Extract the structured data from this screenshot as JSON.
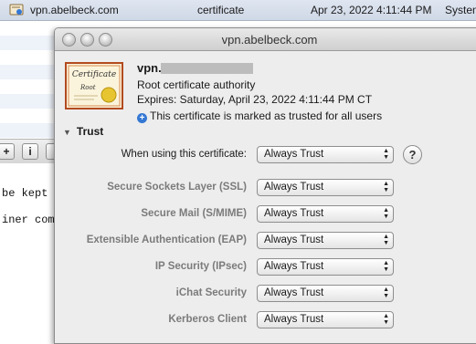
{
  "background_window": {
    "row": {
      "name": "vpn.abelbeck.com",
      "kind": "certificate",
      "date": "Apr 23, 2022 4:11:44 PM",
      "keychain": "System"
    },
    "toolbar": {
      "add_label": "+",
      "info_label": "i"
    },
    "code_lines": [
      "be kept",
      "iner comb"
    ]
  },
  "sheet": {
    "title": "vpn.abelbeck.com",
    "certificate": {
      "icon_text_top": "Certificate",
      "icon_text_bottom": "Root",
      "name_prefix": "vpn.",
      "kind": "Root certificate authority",
      "expires": "Expires: Saturday, April 23, 2022 4:11:44 PM CT",
      "trust_note": "This certificate is marked as trusted for all users"
    },
    "trust": {
      "heading": "Trust",
      "main_label": "When using this certificate:",
      "main_value": "Always Trust",
      "help_label": "?",
      "rows": [
        {
          "label": "Secure Sockets Layer (SSL)",
          "value": "Always Trust"
        },
        {
          "label": "Secure Mail (S/MIME)",
          "value": "Always Trust"
        },
        {
          "label": "Extensible Authentication (EAP)",
          "value": "Always Trust"
        },
        {
          "label": "IP Security (IPsec)",
          "value": "Always Trust"
        },
        {
          "label": "iChat Security",
          "value": "Always Trust"
        },
        {
          "label": "Kerberos Client",
          "value": "Always Trust"
        }
      ]
    }
  },
  "colors": {
    "accent": "#3478d4",
    "seal": "#e7c531"
  },
  "icons": [
    "certificate-icon",
    "plus-circle-icon",
    "disclosure-triangle-icon",
    "help-icon"
  ]
}
